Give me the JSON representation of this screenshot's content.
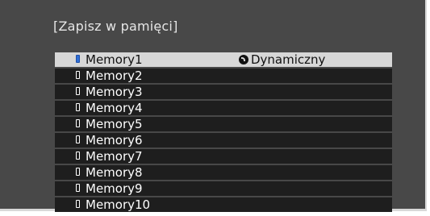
{
  "dialog": {
    "title": "[Zapisz w pamięci]"
  },
  "memory_list": {
    "selected_index": 0,
    "items": [
      {
        "label": "Memory1",
        "mode": "Dynamiczny",
        "mode_icon": "dynamic-mode-icon"
      },
      {
        "label": "Memory2",
        "mode": ""
      },
      {
        "label": "Memory3",
        "mode": ""
      },
      {
        "label": "Memory4",
        "mode": ""
      },
      {
        "label": "Memory5",
        "mode": ""
      },
      {
        "label": "Memory6",
        "mode": ""
      },
      {
        "label": "Memory7",
        "mode": ""
      },
      {
        "label": "Memory8",
        "mode": ""
      },
      {
        "label": "Memory9",
        "mode": ""
      },
      {
        "label": "Memory10",
        "mode": ""
      }
    ]
  },
  "colors": {
    "panel_background": "#484848",
    "row_background": "#1e1e1e",
    "selected_row_background": "#d7d7d7",
    "selected_memory_icon": "#2f6fd6"
  }
}
